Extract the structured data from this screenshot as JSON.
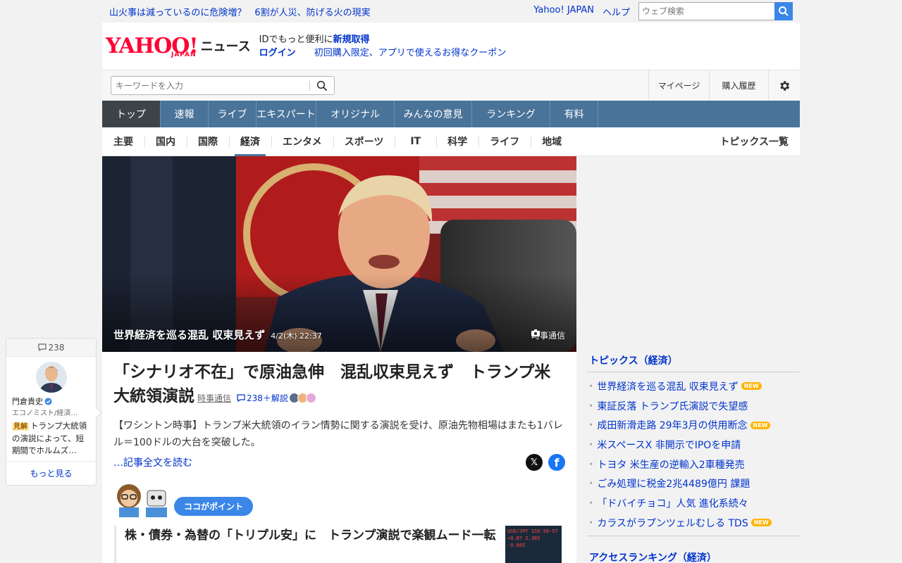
{
  "topbar": {
    "promo_1": "山火事は減っているのに危険増？",
    "promo_2": "6割が人災、防げる火の現実",
    "link_yahoo": "Yahoo! JAPAN",
    "link_help": "ヘルプ",
    "web_search_placeholder": "ウェブ検索"
  },
  "header": {
    "logo_text": "YAHOO!",
    "logo_sub": "JAPAN",
    "service": "ニュース",
    "id_promo_prefix": "IDでもっと便利に",
    "id_promo_link": "新規取得",
    "login": "ログイン",
    "coupon": "初回購入限定、アプリで使えるお得なクーポン"
  },
  "searchrow": {
    "keyword_placeholder": "キーワードを入力",
    "mypage": "マイページ",
    "history": "購入履歴"
  },
  "gnav": {
    "tabs": [
      "トップ",
      "速報",
      "ライブ",
      "エキスパート",
      "オリジナル",
      "みんなの意見",
      "ランキング",
      "有料"
    ]
  },
  "cnav": {
    "cats": [
      "主要",
      "国内",
      "国際",
      "経済",
      "エンタメ",
      "スポーツ",
      "IT",
      "科学",
      "ライフ",
      "地域"
    ],
    "active": "経済",
    "topics_link": "トピックス一覧"
  },
  "hero": {
    "caption": "世界経済を巡る混乱 収束見えず",
    "date": "4/2(木) 22:37",
    "credit": "時事通信"
  },
  "article": {
    "title": "「シナリオ不在」で原油急伸　混乱収束見えず　トランプ米大統領演説",
    "source": "時事通信",
    "comments": "238＋解説",
    "lead": "【ワシントン時事】トランプ米大統領のイラン情勢に関する演説を受け、原油先物相場はまたも1バレル＝100ドルの大台を突破した。",
    "readmore": "…記事全文を読む"
  },
  "point": {
    "label": "ココがポイント",
    "related_title": "株・債券・為替の「トリプル安」に　トランプ演説で楽観ムード一転",
    "thumb_text": "USD/JPY 159.56-57 +0.87 2.385 -0.085"
  },
  "side": {
    "topics_heading": "トピックス（経済）",
    "topics": [
      {
        "text": "世界経済を巡る混乱 収束見えず",
        "new": "NEW"
      },
      {
        "text": "東証反落 トランプ氏演説で失望感",
        "new": ""
      },
      {
        "text": "成田新滑走路 29年3月の供用断念",
        "new": "NEW"
      },
      {
        "text": "米スペースX 非開示でIPOを申請",
        "new": ""
      },
      {
        "text": "トヨタ 米生産の逆輸入2車種発売",
        "new": ""
      },
      {
        "text": "ごみ処理に税金2兆4489億円 課題",
        "new": ""
      },
      {
        "text": "「ドバイチョコ」人気 進化系続々",
        "new": ""
      },
      {
        "text": "カラスがラプンツェルむしる TDS",
        "new": "NEW"
      }
    ],
    "ranking_heading": "アクセスランキング（経済）"
  },
  "comment_card": {
    "count": "238",
    "name": "門倉貴史",
    "role": "エコノミスト/経済…",
    "tag": "見解",
    "body": "トランプ大統領の演説によって、短期間でホルムズ…",
    "more": "もっと見る"
  }
}
